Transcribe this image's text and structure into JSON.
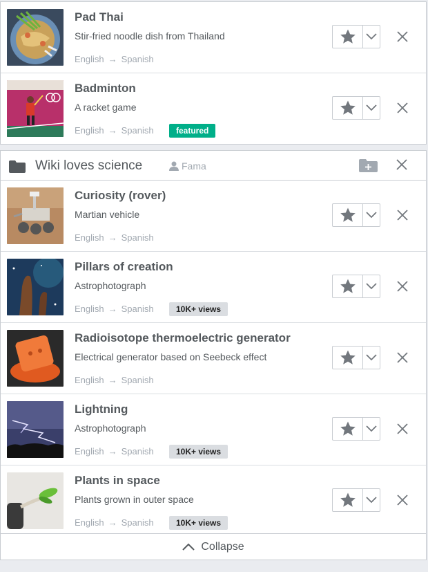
{
  "top_items": [
    {
      "title": "Pad Thai",
      "description": "Stir-fried noodle dish from Thailand",
      "source_lang": "English",
      "arrow": "→",
      "target_lang": "Spanish",
      "tag": ""
    },
    {
      "title": "Badminton",
      "description": "A racket game",
      "source_lang": "English",
      "arrow": "→",
      "target_lang": "Spanish",
      "tag": "featured"
    }
  ],
  "group": {
    "name": "Wiki loves science",
    "owner": "Fama",
    "items": [
      {
        "title": "Curiosity (rover)",
        "description": "Martian vehicle",
        "source_lang": "English",
        "arrow": "→",
        "target_lang": "Spanish",
        "tag": ""
      },
      {
        "title": "Pillars of creation",
        "description": "Astrophotograph",
        "source_lang": "English",
        "arrow": "→",
        "target_lang": "Spanish",
        "tag": "10K+ views"
      },
      {
        "title": "Radioisotope thermoelectric generator",
        "description": "Electrical generator based on Seebeck effect",
        "source_lang": "English",
        "arrow": "→",
        "target_lang": "Spanish",
        "tag": ""
      },
      {
        "title": "Lightning",
        "description": "Astrophotograph",
        "source_lang": "English",
        "arrow": "→",
        "target_lang": "Spanish",
        "tag": "10K+ views"
      },
      {
        "title": "Plants in space",
        "description": "Plants grown in outer space",
        "source_lang": "English",
        "arrow": "→",
        "target_lang": "Spanish",
        "tag": "10K+ views"
      }
    ]
  },
  "collapse_label": "Collapse",
  "icons": {
    "star": "star-icon",
    "dropdown": "chevron-down-icon",
    "close": "close-icon",
    "folder": "folder-icon",
    "add_folder": "folder-add-icon",
    "user": "user-icon",
    "collapse": "chevron-up-icon"
  },
  "colors": {
    "featured": "#00af89",
    "views_bg": "#dadde1",
    "muted": "#a2a9b1",
    "icon_gray": "#72777d"
  }
}
